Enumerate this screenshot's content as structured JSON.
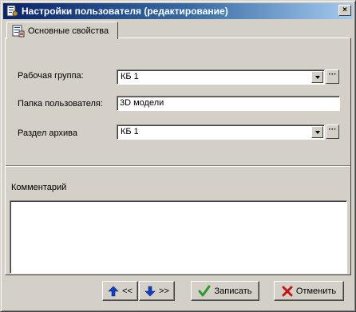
{
  "window": {
    "title": "Настройки пользователя (редактирование)",
    "close_label": "×"
  },
  "tab": {
    "label": "Основные свойства"
  },
  "fields": {
    "workgroup": {
      "label": "Рабочая группа:",
      "value": "КБ 1",
      "ellipsis": "···"
    },
    "user_folder": {
      "label": "Папка пользователя:",
      "value": "3D модели"
    },
    "archive_section": {
      "label": "Раздел архива",
      "value": "КБ 1",
      "ellipsis": "···"
    }
  },
  "comment": {
    "label": "Комментарий",
    "value": ""
  },
  "buttons": {
    "prev_label": "<<",
    "next_label": ">>",
    "save_label": "Записать",
    "cancel_label": "Отменить"
  },
  "colors": {
    "title_start": "#0a246a",
    "title_end": "#a6caf0",
    "face": "#d4d0c8",
    "arrow_blue": "#1040c8",
    "check_green": "#2a9a2a",
    "cancel_red": "#c01818"
  },
  "icons": {
    "title": "user-settings-icon",
    "tab": "properties-icon",
    "prev": "arrow-up-icon",
    "next": "arrow-down-icon",
    "save": "checkmark-icon",
    "cancel": "red-x-icon"
  }
}
